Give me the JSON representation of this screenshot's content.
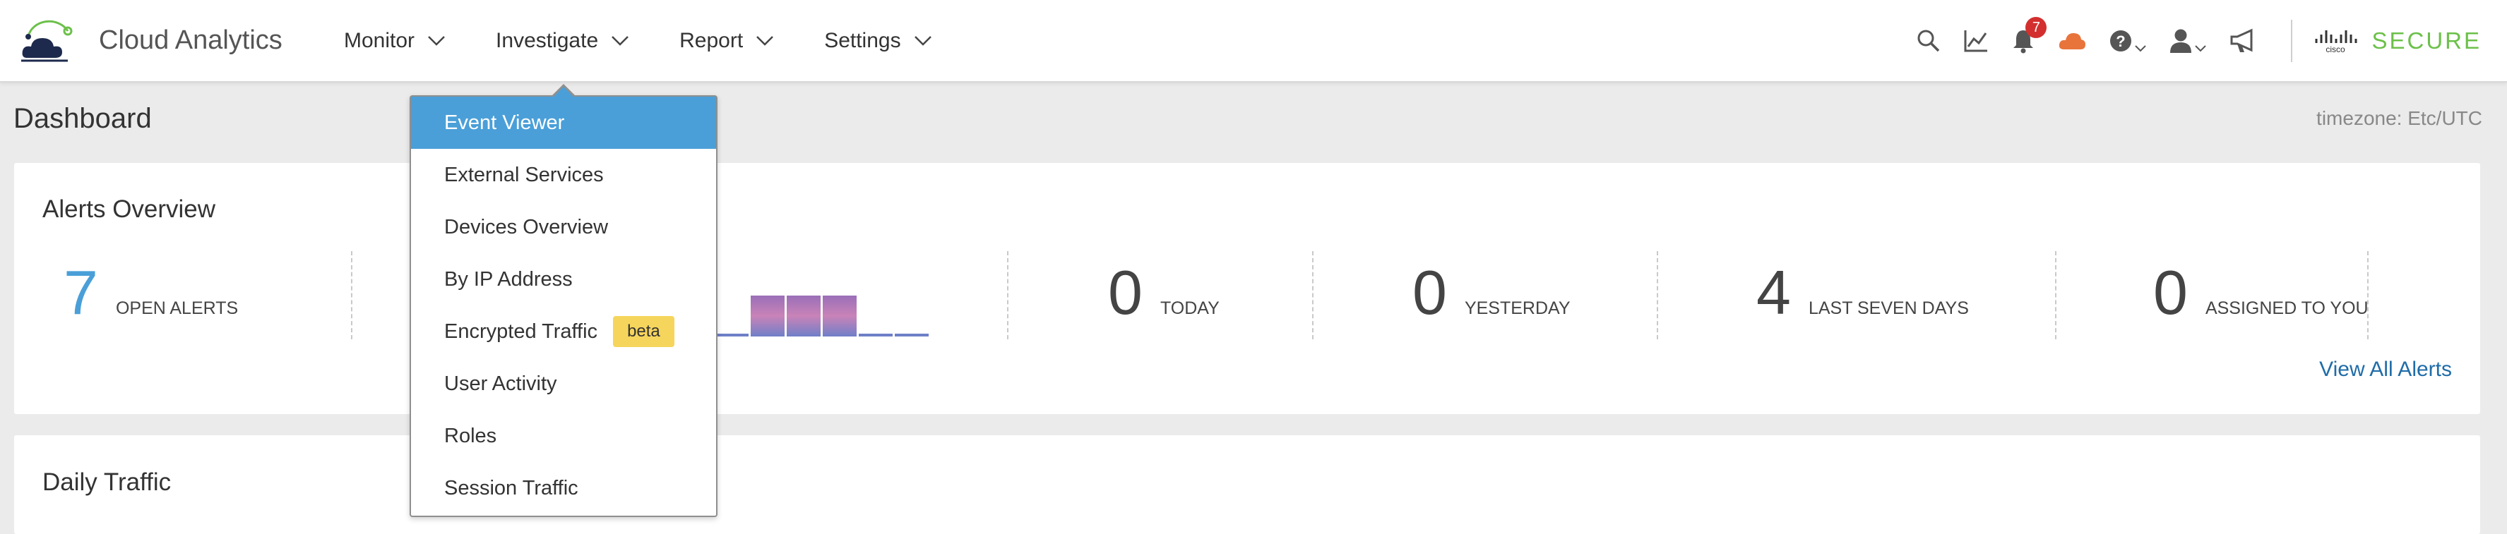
{
  "app": {
    "name": "Cloud Analytics"
  },
  "nav": [
    {
      "label": "Monitor"
    },
    {
      "label": "Investigate"
    },
    {
      "label": "Report"
    },
    {
      "label": "Settings"
    }
  ],
  "toolbar": {
    "notification_count": "7",
    "icons": [
      "search-icon",
      "chart-icon",
      "bell-icon",
      "cloud-icon",
      "help-icon",
      "user-icon",
      "megaphone-icon"
    ],
    "brand_logo": "cisco",
    "brand_word": "SECURE"
  },
  "page": {
    "title": "Dashboard",
    "timezone": "timezone: Etc/UTC"
  },
  "alerts": {
    "title": "Alerts Overview",
    "open": {
      "value": "7",
      "label": "OPEN ALERTS"
    },
    "today": {
      "value": "0",
      "label": "TODAY"
    },
    "yesterday": {
      "value": "0",
      "label": "YESTERDAY"
    },
    "last7": {
      "value": "4",
      "label": "LAST SEVEN DAYS"
    },
    "assigned": {
      "value": "0",
      "label": "ASSIGNED TO YOU"
    },
    "view_all": "View All Alerts"
  },
  "histogram": {
    "values": [
      0,
      1,
      1,
      1,
      0,
      0
    ]
  },
  "daily": {
    "title": "Daily Traffic"
  },
  "investigate_menu": [
    {
      "label": "Event Viewer",
      "active": true
    },
    {
      "label": "External Services"
    },
    {
      "label": "Devices Overview"
    },
    {
      "label": "By IP Address"
    },
    {
      "label": "Encrypted Traffic",
      "tag": "beta"
    },
    {
      "label": "User Activity"
    },
    {
      "label": "Roles"
    },
    {
      "label": "Session Traffic"
    }
  ],
  "colors": {
    "accent": "#4a9fd8",
    "badge": "#d32f2f",
    "secure_green": "#6cc04a",
    "cloud_orange": "#e8743b",
    "beta": "#f6d55c"
  }
}
